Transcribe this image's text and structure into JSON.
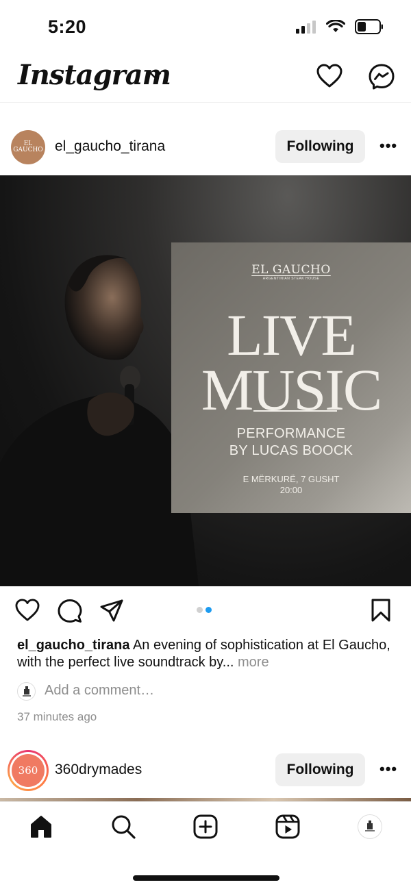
{
  "status_bar": {
    "time": "5:20"
  },
  "header": {
    "logo_text": "Instagram"
  },
  "post1": {
    "username": "el_gaucho_tirana",
    "avatar_text": "EL GAUCHO",
    "follow_label": "Following",
    "more_label": "•••",
    "poster": {
      "brand": "EL GAUCHO",
      "brand_sub": "ARGENTINIAN STEAK HOUSE",
      "title_line1": "LIVE",
      "title_line2": "MUSIC",
      "perf_line1": "PERFORMANCE",
      "perf_line2": "BY LUCAS BOOCK",
      "date": "E MËRKURË, 7 GUSHT",
      "time": "20:00"
    },
    "carousel": {
      "count": 2,
      "active_index": 1
    },
    "caption_username": "el_gaucho_tirana",
    "caption_text": " An evening of sophistication at El Gaucho,  with the perfect live soundtrack by...",
    "caption_more": " more",
    "comment_placeholder": "Add a comment…",
    "time_ago": "37 minutes ago"
  },
  "post2": {
    "username": "360drymades",
    "avatar_text": "360",
    "follow_label": "Following",
    "more_label": "•••"
  },
  "colors": {
    "accent_blue": "#1d9bf0",
    "button_bg": "#efefef",
    "muted_text": "#8e8e8e"
  }
}
